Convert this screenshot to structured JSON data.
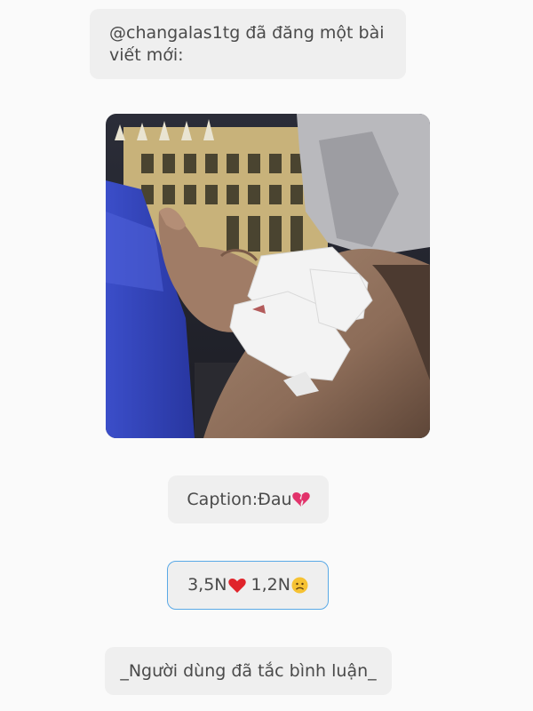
{
  "post": {
    "header_text": "@changalas1tg đã đăng một bài viết mới:",
    "photo_icon": "injured-knee-photo",
    "caption_text": "Caption:Đau",
    "caption_icon": "broken-heart-icon",
    "likes": "3,5N",
    "likes_icon": "heart-icon",
    "dislikes": "1,2N",
    "dislikes_icon": "sad-face-icon",
    "comments_notice": "_Người dùng đã tắc bình luận_"
  },
  "colors": {
    "background": "#fafafa",
    "bubble": "#efefef",
    "text": "#4a4a4a",
    "stats_border": "#5aa9e6"
  }
}
